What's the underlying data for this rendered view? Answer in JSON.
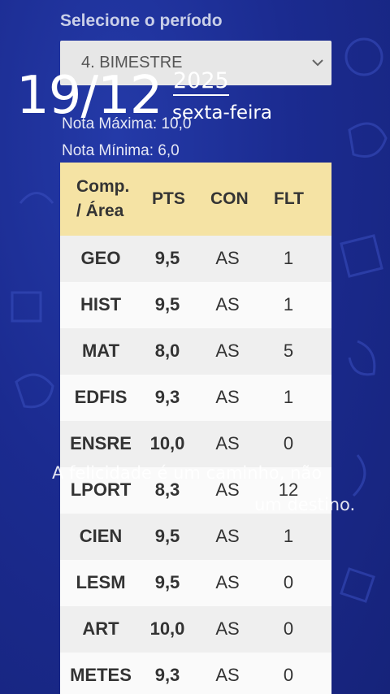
{
  "period": {
    "label": "Selecione o período",
    "selected": "4. BIMESTRE"
  },
  "notes": {
    "max": "Nota Máxima: 10,0",
    "min": "Nota Mínima: 6,0"
  },
  "overlay": {
    "date": "19/12",
    "year": "2025",
    "weekday": "sexta-feira",
    "quote_line1": "A felicidade é um caminho, não",
    "quote_line2": "um destino."
  },
  "table": {
    "headers": {
      "area_line1": "Comp.",
      "area_line2": "/ Área",
      "pts": "PTS",
      "con": "CON",
      "flt": "FLT"
    },
    "rows": [
      {
        "area": "GEO",
        "pts": "9,5",
        "con": "AS",
        "flt": "1"
      },
      {
        "area": "HIST",
        "pts": "9,5",
        "con": "AS",
        "flt": "1"
      },
      {
        "area": "MAT",
        "pts": "8,0",
        "con": "AS",
        "flt": "5"
      },
      {
        "area": "EDFIS",
        "pts": "9,3",
        "con": "AS",
        "flt": "1"
      },
      {
        "area": "ENSRE",
        "pts": "10,0",
        "con": "AS",
        "flt": "0"
      },
      {
        "area": "LPORT",
        "pts": "8,3",
        "con": "AS",
        "flt": "12"
      },
      {
        "area": "CIEN",
        "pts": "9,5",
        "con": "AS",
        "flt": "1"
      },
      {
        "area": "LESM",
        "pts": "9,5",
        "con": "AS",
        "flt": "0"
      },
      {
        "area": "ART",
        "pts": "10,0",
        "con": "AS",
        "flt": "0"
      },
      {
        "area": "METES",
        "pts": "9,3",
        "con": "AS",
        "flt": "0"
      }
    ]
  },
  "colors": {
    "background": "#1a2a8c",
    "header": "#f5e3a4",
    "row_odd": "#efefef",
    "row_even": "#fafafa"
  }
}
